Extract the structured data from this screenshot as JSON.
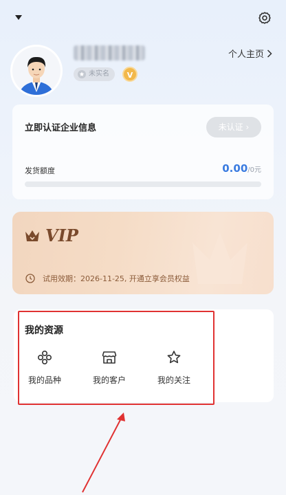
{
  "header": {
    "dropdown_icon": "caret-down-icon",
    "settings_icon": "gear-icon"
  },
  "profile": {
    "avatar_icon": "user-avatar",
    "unverified_badge": "未实名",
    "vip_badge": "V",
    "home_link": "个人主页",
    "home_chevron": "chevron-right-icon"
  },
  "certification": {
    "title": "立即认证企业信息",
    "button": "未认证",
    "quota_label": "发货额度",
    "quota_value": "0.00",
    "quota_unit": "/0元",
    "quota_progress": 0
  },
  "vip": {
    "title": "VIP",
    "trial_text": "试用效期：2026-11-25, 开通立享会员权益",
    "crown_icon": "crown-icon",
    "clock_icon": "clock-icon"
  },
  "resources": {
    "title": "我的资源",
    "items": [
      {
        "label": "我的品种",
        "icon": "variety-icon"
      },
      {
        "label": "我的客户",
        "icon": "store-icon"
      },
      {
        "label": "我的关注",
        "icon": "star-icon"
      }
    ]
  },
  "colors": {
    "accent_blue": "#3a7be0",
    "annotation_red": "#e03131",
    "vip_brown": "#7a4a2c"
  }
}
